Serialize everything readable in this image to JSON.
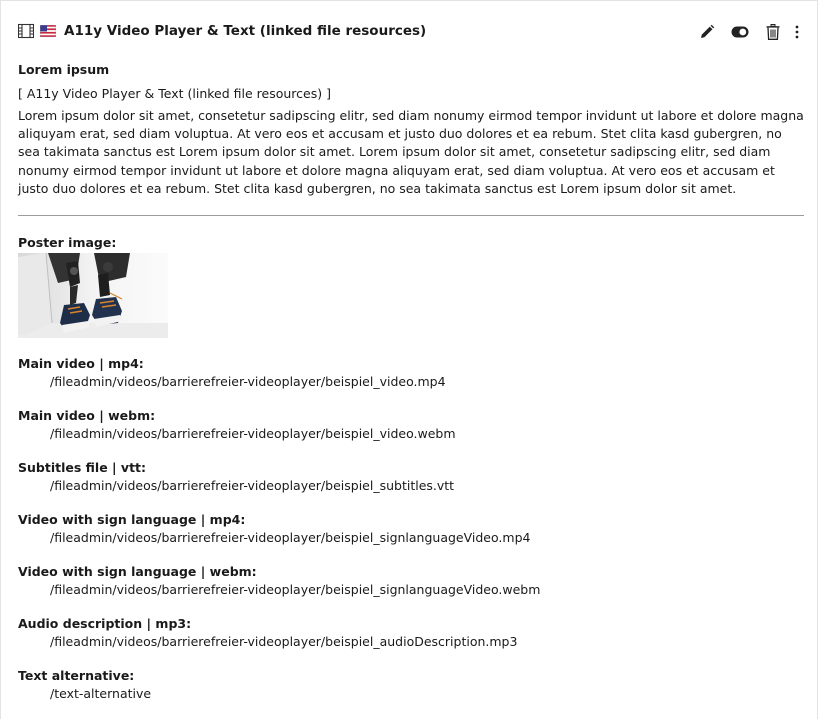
{
  "header": {
    "title": "A11y Video Player & Text (linked file resources)",
    "icons": [
      "film-icon",
      "us-flag-icon"
    ],
    "actions": [
      "edit-icon",
      "toggle-icon",
      "trash-icon",
      "more-icon"
    ]
  },
  "content": {
    "headline": "Lorem ipsum",
    "ctype_label": "[ A11y Video Player & Text (linked file resources) ]",
    "bodytext": "Lorem ipsum dolor sit amet, consetetur sadipscing elitr, sed diam nonumy eirmod tempor invidunt ut labore et dolore magna aliquyam erat, sed diam voluptua. At vero eos et accusam et justo duo dolores et ea rebum. Stet clita kasd gubergren, no sea takimata sanctus est Lorem ipsum dolor sit amet. Lorem ipsum dolor sit amet, consetetur sadipscing elitr, sed diam nonumy eirmod tempor invidunt ut labore et dolore magna aliquyam erat, sed diam voluptua. At vero eos et accusam et justo duo dolores et ea rebum. Stet clita kasd gubergren, no sea takimata sanctus est Lorem ipsum dolor sit amet.",
    "poster_label": "Poster image:"
  },
  "resources": [
    {
      "label": "Main video | mp4:",
      "path": "/fileadmin/videos/barrierefreier-videoplayer/beispiel_video.mp4"
    },
    {
      "label": "Main video | webm:",
      "path": "/fileadmin/videos/barrierefreier-videoplayer/beispiel_video.webm"
    },
    {
      "label": "Subtitles file | vtt:",
      "path": "/fileadmin/videos/barrierefreier-videoplayer/beispiel_subtitles.vtt"
    },
    {
      "label": "Video with sign language | mp4:",
      "path": "/fileadmin/videos/barrierefreier-videoplayer/beispiel_signlanguageVideo.mp4"
    },
    {
      "label": "Video with sign language | webm:",
      "path": "/fileadmin/videos/barrierefreier-videoplayer/beispiel_signlanguageVideo.webm"
    },
    {
      "label": "Audio description | mp3:",
      "path": "/fileadmin/videos/barrierefreier-videoplayer/beispiel_audioDescription.mp3"
    },
    {
      "label": "Text alternative:",
      "path": "/text-alternative"
    }
  ]
}
